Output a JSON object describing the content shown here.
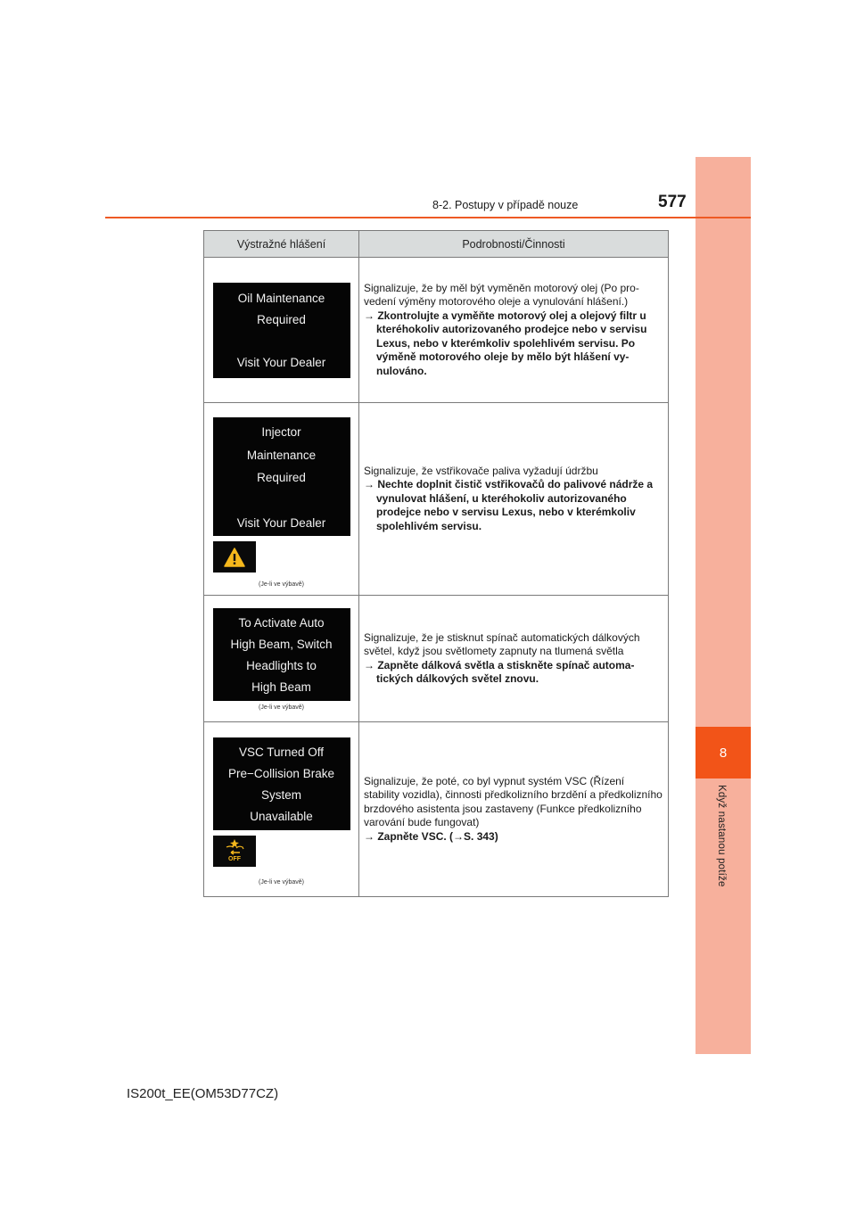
{
  "header": {
    "section": "8-2. Postupy v případě nouze",
    "page_number": "577"
  },
  "side_tab": {
    "chapter": "8",
    "label": "Když nastanou potíže"
  },
  "table": {
    "headers": [
      "Výstražné hlášení",
      "Podrobnosti/Činnosti"
    ],
    "rows": [
      {
        "display_lines": [
          "Oil Maintenance",
          "Required",
          "",
          "Visit Your Dealer"
        ],
        "indicator": null,
        "note": null,
        "description": "Signalizuje, že by měl být vyměněn motorový olej (Po pro­vedení výměny motorového oleje a vynulování hlášení.)",
        "action": "Zkontrolujte a vyměňte motorový olej a olejový filtr u kteréhokoliv autorizovaného prodejce nebo v ser­visu Lexus, nebo v kterémkoliv spolehlivém servisu. Po výměně motorového oleje by mělo být hlášení vy­nulováno."
      },
      {
        "display_lines": [
          "Injector",
          "Maintenance",
          "Required",
          "",
          "Visit Your Dealer"
        ],
        "indicator": "warning-triangle",
        "note": "(Je-li ve výbavě)",
        "description": "Signalizuje, že vstřikovače paliva vyžadují údržbu",
        "action": "Nechte doplnit čistič vstřikovačů do palivové nádrže a vynulovat hlášení, u kteréhokoliv autorizovaného prodejce nebo v servisu Lexus, nebo v kterémkoliv spolehlivém servisu."
      },
      {
        "display_lines": [
          "To Activate Auto",
          "High Beam, Switch",
          "Headlights to",
          "High Beam"
        ],
        "indicator": null,
        "note": "(Je-li ve výbavě)",
        "description": "Signalizuje, že je stisknut spínač automatických dálko­vých světel, když jsou světlomety zapnuty na tlumená světla",
        "action": "Zapněte dálková světla a stiskněte spínač automa­tických dálkových světel znovu."
      },
      {
        "display_lines": [
          "VSC Turned Off",
          "Pre−Collision Brake",
          "System",
          "Unavailable"
        ],
        "indicator": "pcs-off",
        "indicator_text": "OFF",
        "note": "(Je-li ve výbavě)",
        "description": "Signalizuje, že poté, co byl vypnut systém VSC (Řízení stability vozidla), činnosti předkolizního brzdění a před­kolizního brzdového asistenta jsou zastaveny (Funkce předkolizního varování bude fungovat)",
        "action": "Zapněte VSC. (→S. 343)"
      }
    ],
    "arrow": "→"
  },
  "footer": {
    "model_code": "IS200t_EE(OM53D77CZ)"
  },
  "colors": {
    "accent": "#f25418",
    "side_strip": "#f7b09c",
    "indicator_amber": "#f6b81c"
  }
}
